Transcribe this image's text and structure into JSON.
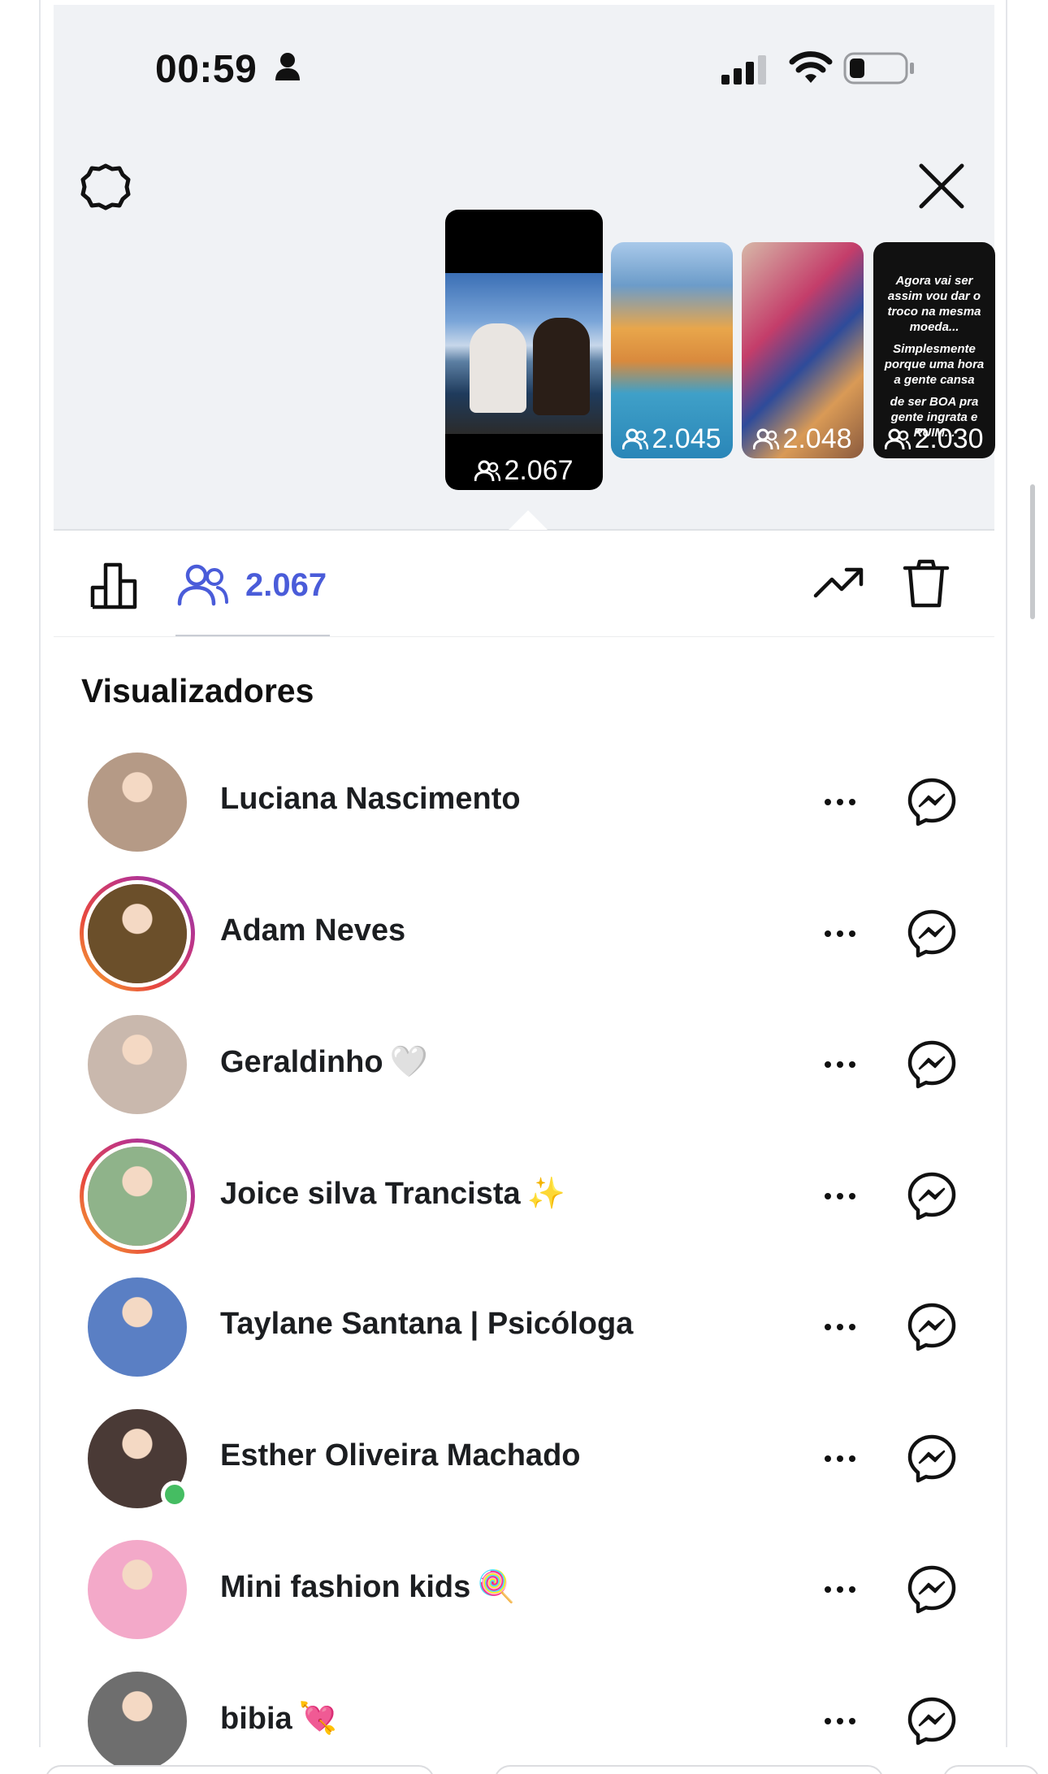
{
  "status_bar": {
    "time": "00:59",
    "person_icon": "person-fill-icon",
    "signal_icon": "cellular-signal-icon",
    "wifi_icon": "wifi-icon",
    "battery_icon": "battery-low-icon"
  },
  "header": {
    "settings_icon": "gear-icon",
    "close_icon": "close-icon"
  },
  "stories": [
    {
      "viewers": "2.067",
      "selected": true,
      "kind": "photo"
    },
    {
      "viewers": "2.045",
      "selected": false,
      "kind": "pool"
    },
    {
      "viewers": "2.048",
      "selected": false,
      "kind": "colorful"
    },
    {
      "viewers": "2.030",
      "selected": false,
      "kind": "text",
      "lines": [
        "Agora vai ser assim vou dar o troco na mesma moeda...",
        "Simplesmente porque uma hora a gente cansa",
        "de ser BOA pra gente ingrata e RUIM. ."
      ]
    }
  ],
  "tabs": {
    "insights_icon": "bar-chart-icon",
    "viewers_icon": "people-icon",
    "viewers_count": "2.067",
    "promote_icon": "trending-up-icon",
    "delete_icon": "trash-icon"
  },
  "section": {
    "title": "Visualizadores"
  },
  "viewers": [
    {
      "name": "Luciana Nascimento",
      "emoji": "",
      "ring": false,
      "online": false,
      "avatar_color": "#b59a86"
    },
    {
      "name": "Adam Neves",
      "emoji": "",
      "ring": true,
      "online": false,
      "avatar_color": "#6b4f2a"
    },
    {
      "name": "Geraldinho",
      "emoji": "🤍",
      "ring": false,
      "online": false,
      "avatar_color": "#c9b8ad"
    },
    {
      "name": "Joice silva Trancista",
      "emoji": "✨",
      "ring": true,
      "online": false,
      "avatar_color": "#8fb38a"
    },
    {
      "name": "Taylane Santana | Psicóloga",
      "emoji": "",
      "ring": false,
      "online": false,
      "avatar_color": "#5a7fc4"
    },
    {
      "name": "Esther Oliveira Machado",
      "emoji": "",
      "ring": false,
      "online": true,
      "avatar_color": "#4a3a36"
    },
    {
      "name": "Mini fashion kids",
      "emoji": "🍭",
      "ring": false,
      "online": false,
      "avatar_color": "#f3a9c9"
    },
    {
      "name": "bibia",
      "emoji": "💘",
      "ring": false,
      "online": false,
      "avatar_color": "#6e6e6e"
    }
  ],
  "row_icons": {
    "more": "more-horizontal-icon",
    "message": "messenger-icon"
  }
}
